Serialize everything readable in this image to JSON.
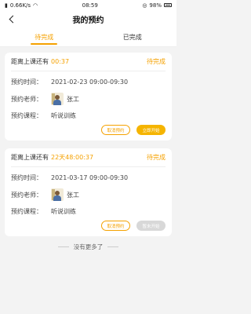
{
  "status_bar": {
    "network": "0.66K/s",
    "time": "08:59",
    "battery": "98%"
  },
  "nav": {
    "title": "我的预约"
  },
  "tabs": [
    {
      "label": "待完成"
    },
    {
      "label": "已完成"
    }
  ],
  "labels": {
    "time": "预约时间：",
    "teacher": "预约老师：",
    "course": "预约课程："
  },
  "cards": [
    {
      "countdown_label": "距离上课还有",
      "countdown": "00:37",
      "status": "待完成",
      "time": "2021-02-23 09:00-09:30",
      "teacher": "张工",
      "course": "听说训练",
      "cancel_label": "取消预约",
      "start_label": "立即开始"
    },
    {
      "countdown_label": "距离上课还有",
      "countdown": "22天48:00:37",
      "status": "待完成",
      "time": "2021-03-17 09:00-09:30",
      "teacher": "张工",
      "course": "听说训练",
      "cancel_label": "取消预约",
      "start_label": "暂未开始"
    }
  ],
  "footer": "没有更多了",
  "colors": {
    "accent": "#f5a100"
  }
}
